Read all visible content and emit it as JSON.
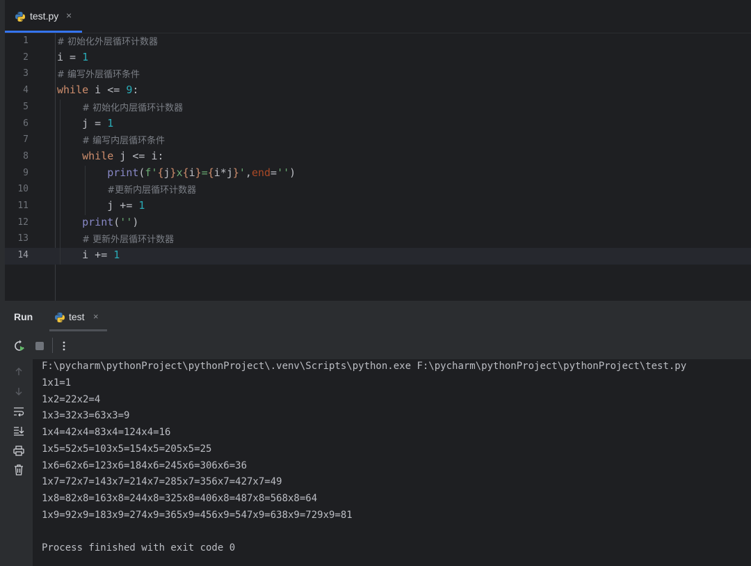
{
  "editor_tab": {
    "filename": "test.py",
    "close_glyph": "×",
    "icon": "python-icon"
  },
  "editor": {
    "lines": [
      {
        "n": "1",
        "indent": 0,
        "tokens": [
          [
            "cmt",
            "# 初始化外层循环计数器"
          ]
        ]
      },
      {
        "n": "2",
        "indent": 0,
        "tokens": [
          [
            "ex",
            "i = "
          ],
          [
            "num",
            "1"
          ]
        ]
      },
      {
        "n": "3",
        "indent": 0,
        "tokens": [
          [
            "cmt",
            "# 编写外层循环条件"
          ]
        ]
      },
      {
        "n": "4",
        "indent": 0,
        "tokens": [
          [
            "kw",
            "while"
          ],
          [
            "ex",
            " i <= "
          ],
          [
            "num",
            "9"
          ],
          [
            "ex",
            ":"
          ]
        ]
      },
      {
        "n": "5",
        "indent": 1,
        "tokens": [
          [
            "cmt",
            "# 初始化内层循环计数器"
          ]
        ]
      },
      {
        "n": "6",
        "indent": 1,
        "tokens": [
          [
            "ex",
            "j = "
          ],
          [
            "num",
            "1"
          ]
        ]
      },
      {
        "n": "7",
        "indent": 1,
        "tokens": [
          [
            "cmt",
            "# 编写内层循环条件"
          ]
        ]
      },
      {
        "n": "8",
        "indent": 1,
        "tokens": [
          [
            "kw",
            "while"
          ],
          [
            "ex",
            " j <= i:"
          ]
        ]
      },
      {
        "n": "9",
        "indent": 2,
        "tokens": [
          [
            "fn",
            "print"
          ],
          [
            "ex",
            "("
          ],
          [
            "str",
            "f'"
          ],
          [
            "br",
            "{"
          ],
          [
            "ex",
            "j"
          ],
          [
            "br",
            "}"
          ],
          [
            "str",
            "x"
          ],
          [
            "br",
            "{"
          ],
          [
            "ex",
            "i"
          ],
          [
            "br",
            "}"
          ],
          [
            "str",
            "="
          ],
          [
            "br",
            "{"
          ],
          [
            "ex",
            "i*j"
          ],
          [
            "br",
            "}"
          ],
          [
            "str",
            "'"
          ],
          [
            "ex",
            ","
          ],
          [
            "named",
            "end"
          ],
          [
            "ex",
            "="
          ],
          [
            "str",
            "''"
          ],
          [
            "ex",
            ")"
          ]
        ]
      },
      {
        "n": "10",
        "indent": 2,
        "tokens": [
          [
            "cmt",
            "#更新内层循环计数器"
          ]
        ]
      },
      {
        "n": "11",
        "indent": 2,
        "tokens": [
          [
            "ex",
            "j += "
          ],
          [
            "num",
            "1"
          ]
        ]
      },
      {
        "n": "12",
        "indent": 1,
        "tokens": [
          [
            "fn",
            "print"
          ],
          [
            "ex",
            "("
          ],
          [
            "str",
            "''"
          ],
          [
            "ex",
            ")"
          ]
        ]
      },
      {
        "n": "13",
        "indent": 1,
        "tokens": [
          [
            "cmt",
            "# 更新外层循环计数器"
          ]
        ]
      },
      {
        "n": "14",
        "indent": 1,
        "tokens": [
          [
            "ex",
            "i += "
          ],
          [
            "num",
            "1"
          ]
        ]
      }
    ],
    "current_line": "14"
  },
  "run_panel": {
    "title": "Run",
    "tab_label": "test",
    "tab_icon": "python-icon",
    "close_glyph": "×",
    "toolbar": [
      "rerun-icon",
      "stop-icon",
      "more-icon"
    ],
    "side_tools": [
      "arrow-up-icon",
      "arrow-down-icon",
      "soft-wrap-icon",
      "scroll-to-end-icon",
      "print-icon",
      "trash-icon"
    ]
  },
  "console": {
    "lines": [
      "F:\\pycharm\\pythonProject\\pythonProject\\.venv\\Scripts\\python.exe F:\\pycharm\\pythonProject\\pythonProject\\test.py",
      "1x1=1",
      "1x2=22x2=4",
      "1x3=32x3=63x3=9",
      "1x4=42x4=83x4=124x4=16",
      "1x5=52x5=103x5=154x5=205x5=25",
      "1x6=62x6=123x6=184x6=245x6=306x6=36",
      "1x7=72x7=143x7=214x7=285x7=356x7=427x7=49",
      "1x8=82x8=163x8=244x8=325x8=406x8=487x8=568x8=64",
      "1x9=92x9=183x9=274x9=365x9=456x9=547x9=638x9=729x9=81",
      "",
      "Process finished with exit code 0"
    ]
  },
  "colors": {
    "background": "#1e1f22",
    "panel": "#2b2d30",
    "keyword": "#cf8e6d",
    "number": "#2aacb8",
    "string": "#6aab73",
    "comment": "#7a7e85",
    "builtin": "#8888c6",
    "accent": "#3574f0",
    "run_green": "#5fb865"
  }
}
